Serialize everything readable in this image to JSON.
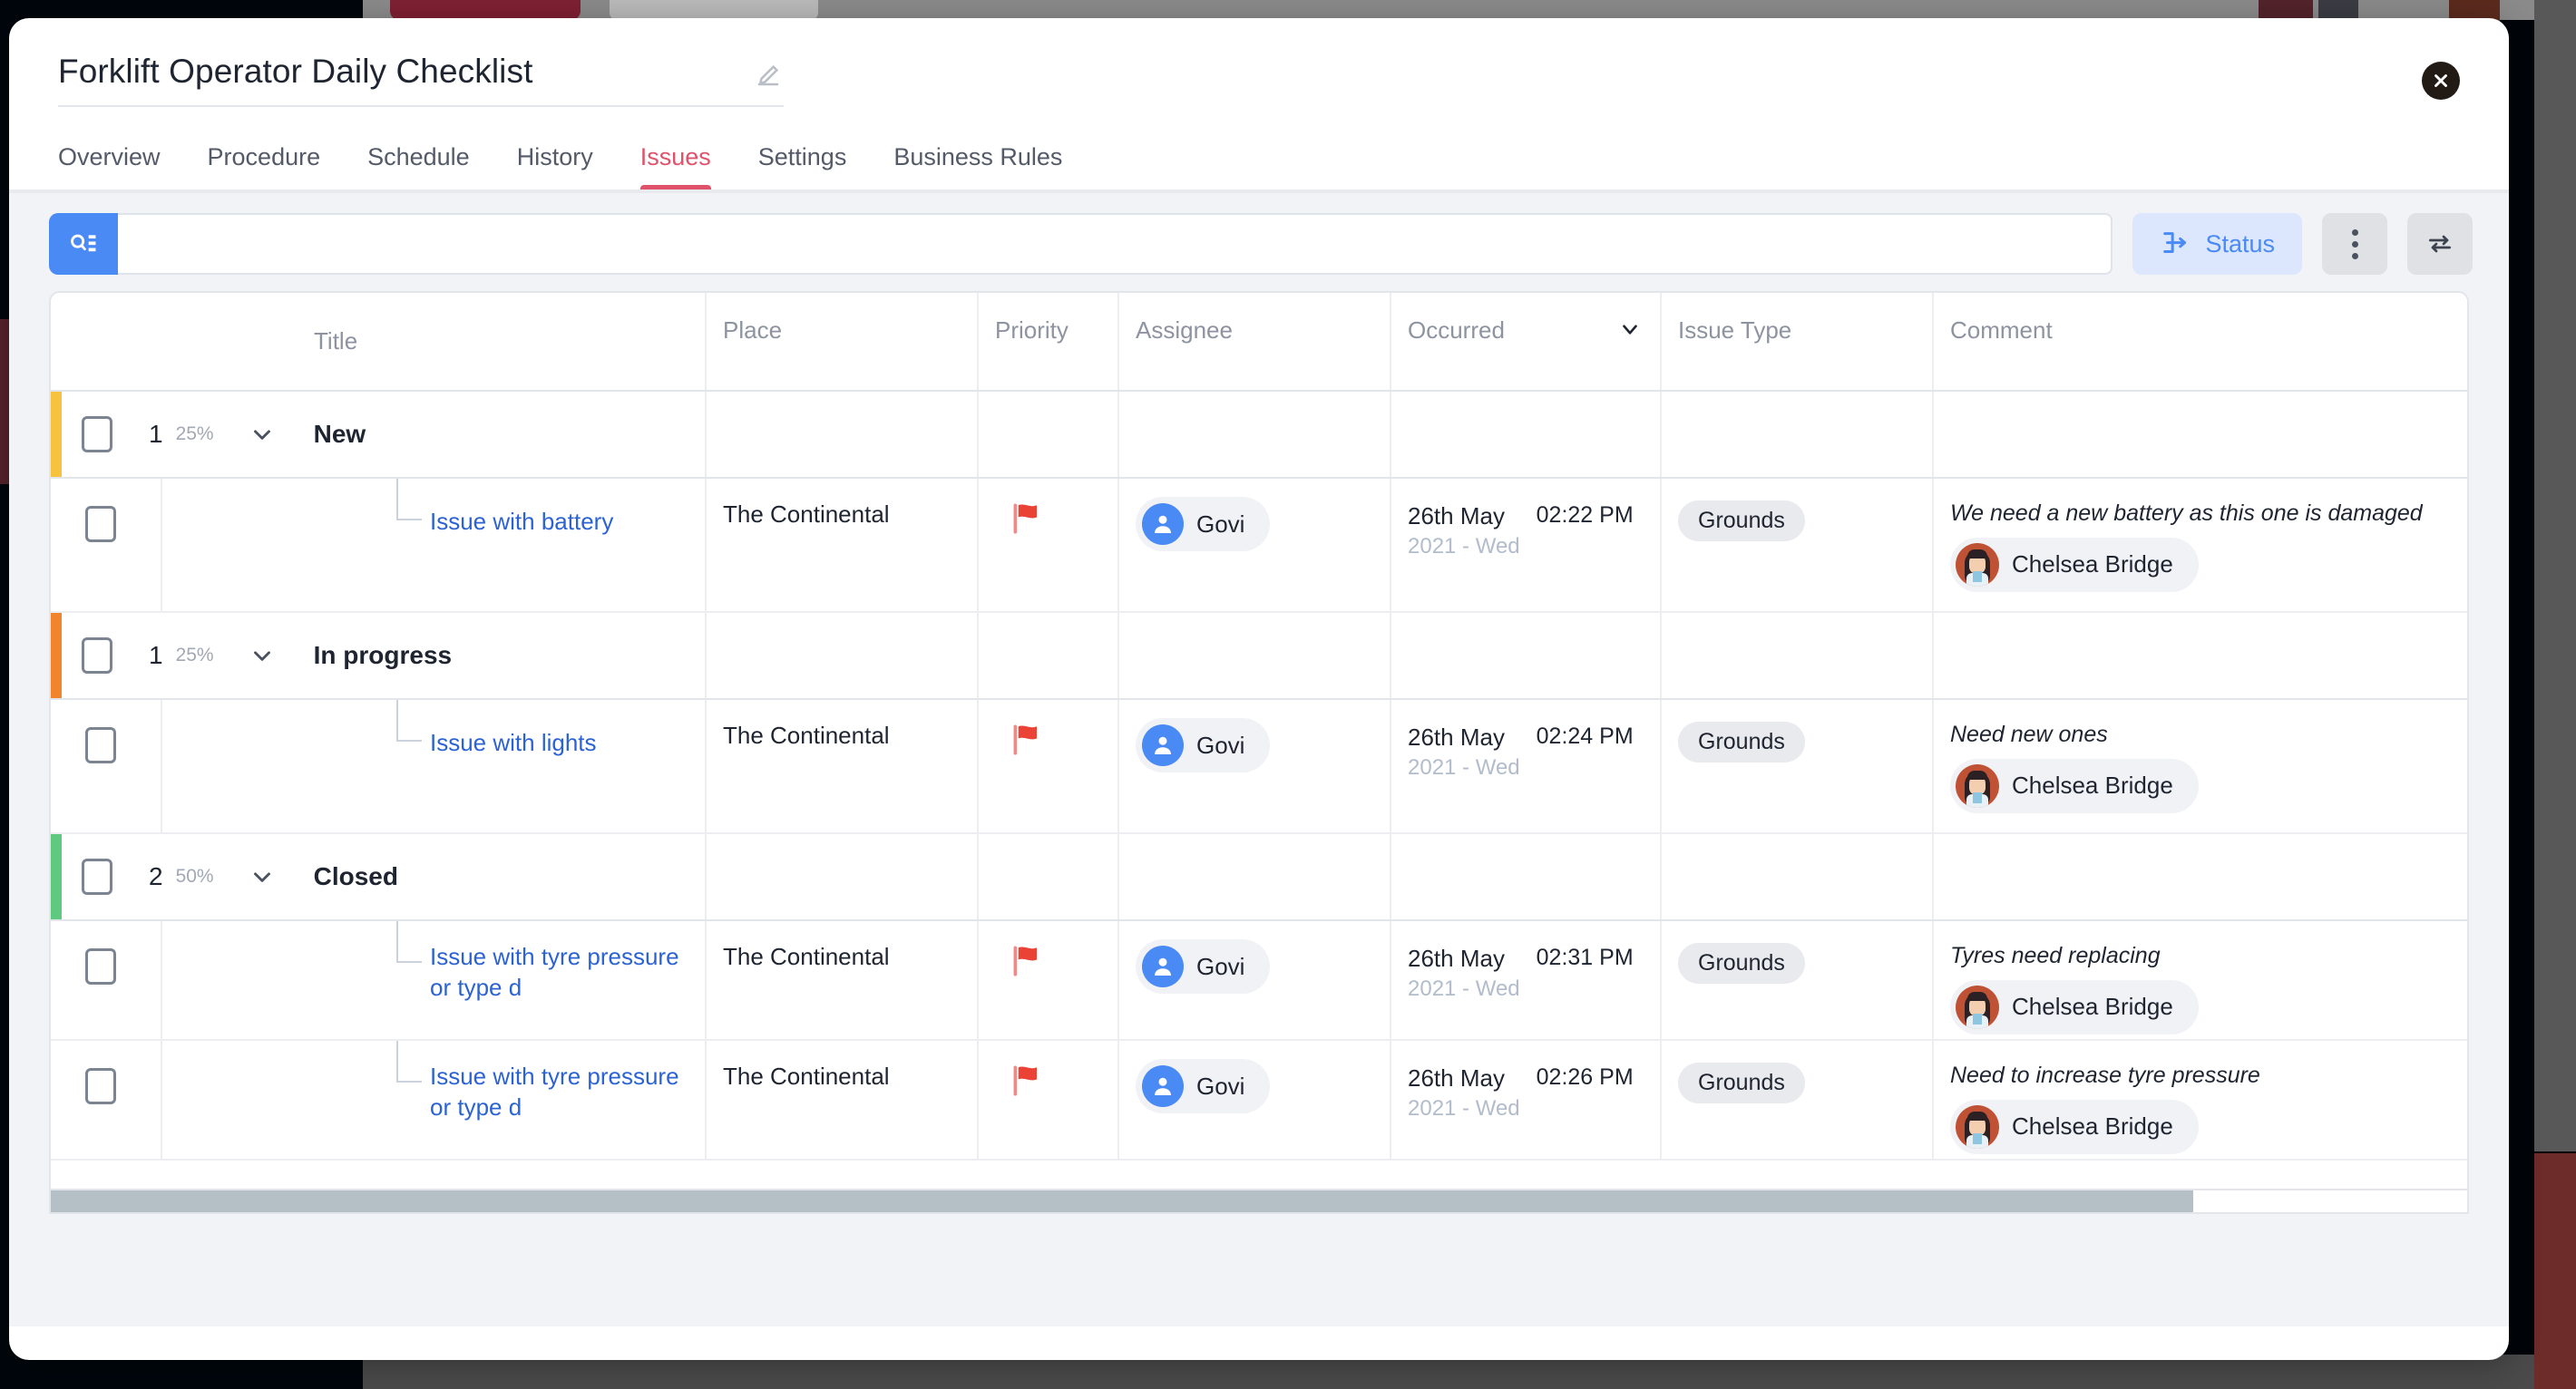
{
  "modal": {
    "title": "Forklift Operator Daily Checklist",
    "edit_icon": "pencil-icon",
    "close_icon": "close-circle-icon"
  },
  "tabs": [
    {
      "label": "Overview",
      "active": false
    },
    {
      "label": "Procedure",
      "active": false
    },
    {
      "label": "Schedule",
      "active": false
    },
    {
      "label": "History",
      "active": false
    },
    {
      "label": "Issues",
      "active": true
    },
    {
      "label": "Settings",
      "active": false
    },
    {
      "label": "Business Rules",
      "active": false
    }
  ],
  "toolbar": {
    "search_placeholder": "",
    "search_value": "",
    "search_icon": "search-list-icon",
    "status_label": "Status",
    "status_icon": "indent-arrow-icon",
    "more_icon": "kebab-menu-icon",
    "swap_icon": "swap-arrows-icon"
  },
  "table": {
    "headers": {
      "title": "Title",
      "place": "Place",
      "priority": "Priority",
      "assignee": "Assignee",
      "occurred": "Occurred",
      "issue_type": "Issue Type",
      "comment": "Comment"
    },
    "sort_caret": "chevron-down",
    "groups": [
      {
        "name": "New",
        "count": "1",
        "percent": "25%",
        "accent": "#f7c33f",
        "rows": [
          {
            "title": "Issue with battery",
            "place": "The Continental",
            "priority_flag": "red-flag",
            "assignee": "Govi",
            "date": "26th May",
            "date_sub": "2021 - Wed",
            "time": "02:22 PM",
            "issue_type": "Grounds",
            "comment": "We need a new battery as this one is damaged",
            "comment_author": "Chelsea Bridge"
          }
        ]
      },
      {
        "name": "In progress",
        "count": "1",
        "percent": "25%",
        "accent": "#f1852d",
        "rows": [
          {
            "title": "Issue with lights",
            "place": "The Continental",
            "priority_flag": "red-flag",
            "assignee": "Govi",
            "date": "26th May",
            "date_sub": "2021 - Wed",
            "time": "02:24 PM",
            "issue_type": "Grounds",
            "comment": "Need new ones",
            "comment_author": "Chelsea Bridge"
          }
        ]
      },
      {
        "name": "Closed",
        "count": "2",
        "percent": "50%",
        "accent": "#5ec97f",
        "rows": [
          {
            "title": "Issue with tyre pressure or type d",
            "place": "The Continental",
            "priority_flag": "red-flag",
            "assignee": "Govi",
            "date": "26th May",
            "date_sub": "2021 - Wed",
            "time": "02:31 PM",
            "issue_type": "Grounds",
            "comment": "Tyres need replacing",
            "comment_author": "Chelsea Bridge"
          },
          {
            "title": "Issue with tyre pressure or type d",
            "place": "The Continental",
            "priority_flag": "red-flag",
            "assignee": "Govi",
            "date": "26th May",
            "date_sub": "2021 - Wed",
            "time": "02:26 PM",
            "issue_type": "Grounds",
            "comment": "Need to increase tyre pressure",
            "comment_author": "Chelsea Bridge"
          }
        ]
      }
    ]
  },
  "colors": {
    "accent_blue": "#4a8af4",
    "tab_active": "#e0516a",
    "link": "#2b62d4"
  }
}
